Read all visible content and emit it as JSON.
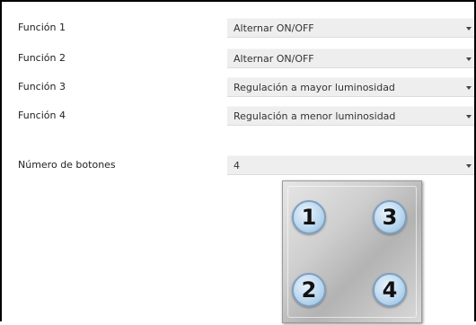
{
  "rows": [
    {
      "label": "Función 1",
      "value": "Alternar ON/OFF"
    },
    {
      "label": "Función 2",
      "value": "Alternar ON/OFF"
    },
    {
      "label": "Función 3",
      "value": "Regulación a mayor luminosidad"
    },
    {
      "label": "Función 4",
      "value": "Regulación a menor luminosidad"
    }
  ],
  "buttons_count": {
    "label": "Número de botones",
    "value": "4"
  },
  "keypad": {
    "keys": [
      "1",
      "3",
      "2",
      "4"
    ]
  },
  "icons": {
    "dropdown": "chevron-down-icon"
  }
}
